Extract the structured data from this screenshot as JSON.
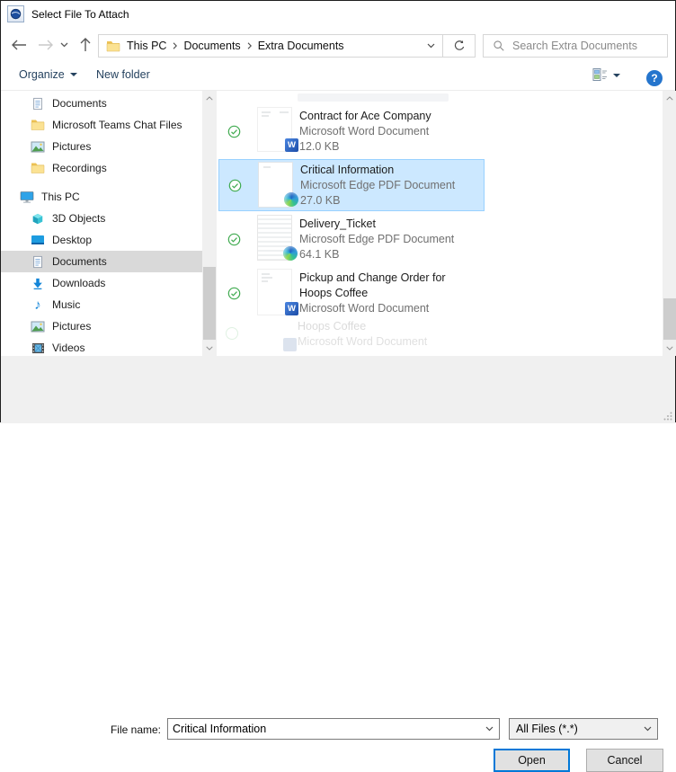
{
  "window": {
    "title": "Select File To Attach"
  },
  "nav": {
    "breadcrumb": {
      "0": "This PC",
      "1": "Documents",
      "2": "Extra Documents"
    },
    "search_placeholder": "Search Extra Documents"
  },
  "toolbar": {
    "organize": "Organize",
    "new_folder": "New folder",
    "help": "?"
  },
  "sidebar": {
    "items": {
      "0": {
        "label": "Documents"
      },
      "1": {
        "label": "Microsoft Teams Chat Files"
      },
      "2": {
        "label": "Pictures"
      },
      "3": {
        "label": "Recordings"
      },
      "4": {
        "label": "This PC"
      },
      "5": {
        "label": "3D Objects"
      },
      "6": {
        "label": "Desktop"
      },
      "7": {
        "label": "Documents",
        "selected": true
      },
      "8": {
        "label": "Downloads"
      },
      "9": {
        "label": "Music"
      },
      "10": {
        "label": "Pictures"
      },
      "11": {
        "label": "Videos"
      }
    }
  },
  "files": {
    "items": {
      "0": {
        "name": "Contract for Ace Company",
        "type": "Microsoft Word Document",
        "size": "12.0 KB",
        "icon": "word"
      },
      "1": {
        "name": "Critical Information",
        "type": "Microsoft Edge PDF Document",
        "size": "27.0 KB",
        "icon": "edge",
        "selected": true
      },
      "2": {
        "name": "Delivery_Ticket",
        "type": "Microsoft Edge PDF Document",
        "size": "64.1 KB",
        "icon": "edge"
      },
      "3": {
        "name": "Pickup and Change Order for Hoops Coffee",
        "type": "Microsoft Word Document",
        "icon": "word"
      }
    },
    "ghost_scroll_remnant": {
      "line1": "Hoops Coffee",
      "line2": "Microsoft Word Document"
    }
  },
  "footer": {
    "file_name_label": "File name:",
    "file_name_value": "Critical Information",
    "file_type_value": "All Files (*.*)",
    "open": "Open",
    "cancel": "Cancel"
  },
  "colors": {
    "accent": "#0078d7",
    "selection_bg": "#cce8ff",
    "selection_border": "#99d1ff",
    "sidebar_selected": "#d9d9d9",
    "folder_yellow": "#f7d978",
    "word_blue": "#2b579a",
    "sync_green": "#3faa4f"
  }
}
